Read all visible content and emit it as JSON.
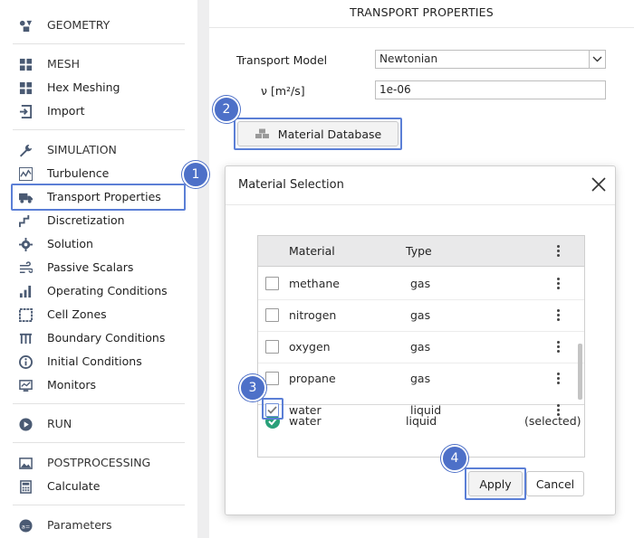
{
  "sidebar": {
    "geometry": "GEOMETRY",
    "mesh": "MESH",
    "hex_meshing": "Hex Meshing",
    "import": "Import",
    "simulation": "SIMULATION",
    "turbulence": "Turbulence",
    "transport_properties": "Transport Properties",
    "discretization": "Discretization",
    "solution": "Solution",
    "passive_scalars": "Passive Scalars",
    "operating_conditions": "Operating Conditions",
    "cell_zones": "Cell Zones",
    "boundary_conditions": "Boundary Conditions",
    "initial_conditions": "Initial Conditions",
    "monitors": "Monitors",
    "run": "RUN",
    "postprocessing": "POSTPROCESSING",
    "calculate": "Calculate",
    "parameters": "Parameters"
  },
  "panel": {
    "title": "TRANSPORT PROPERTIES",
    "transport_model_label": "Transport Model",
    "transport_model_value": "Newtonian",
    "nu_label": "ν [m²/s]",
    "nu_value": "1e-06",
    "material_db_button": "Material Database"
  },
  "dialog": {
    "title": "Material Selection",
    "col_material": "Material",
    "col_type": "Type",
    "rows": [
      {
        "name": "methane",
        "type": "gas",
        "checked": false
      },
      {
        "name": "nitrogen",
        "type": "gas",
        "checked": false
      },
      {
        "name": "oxygen",
        "type": "gas",
        "checked": false
      },
      {
        "name": "propane",
        "type": "gas",
        "checked": false
      },
      {
        "name": "water",
        "type": "liquid",
        "checked": true
      }
    ],
    "selected": {
      "name": "water",
      "type": "liquid",
      "tag": "(selected)"
    },
    "apply": "Apply",
    "cancel": "Cancel"
  },
  "badges": {
    "b1": "1",
    "b2": "2",
    "b3": "3",
    "b4": "4"
  },
  "colors": {
    "accent": "#4d70c8",
    "highlight": "#5b7fd6",
    "success": "#2aa07a"
  }
}
